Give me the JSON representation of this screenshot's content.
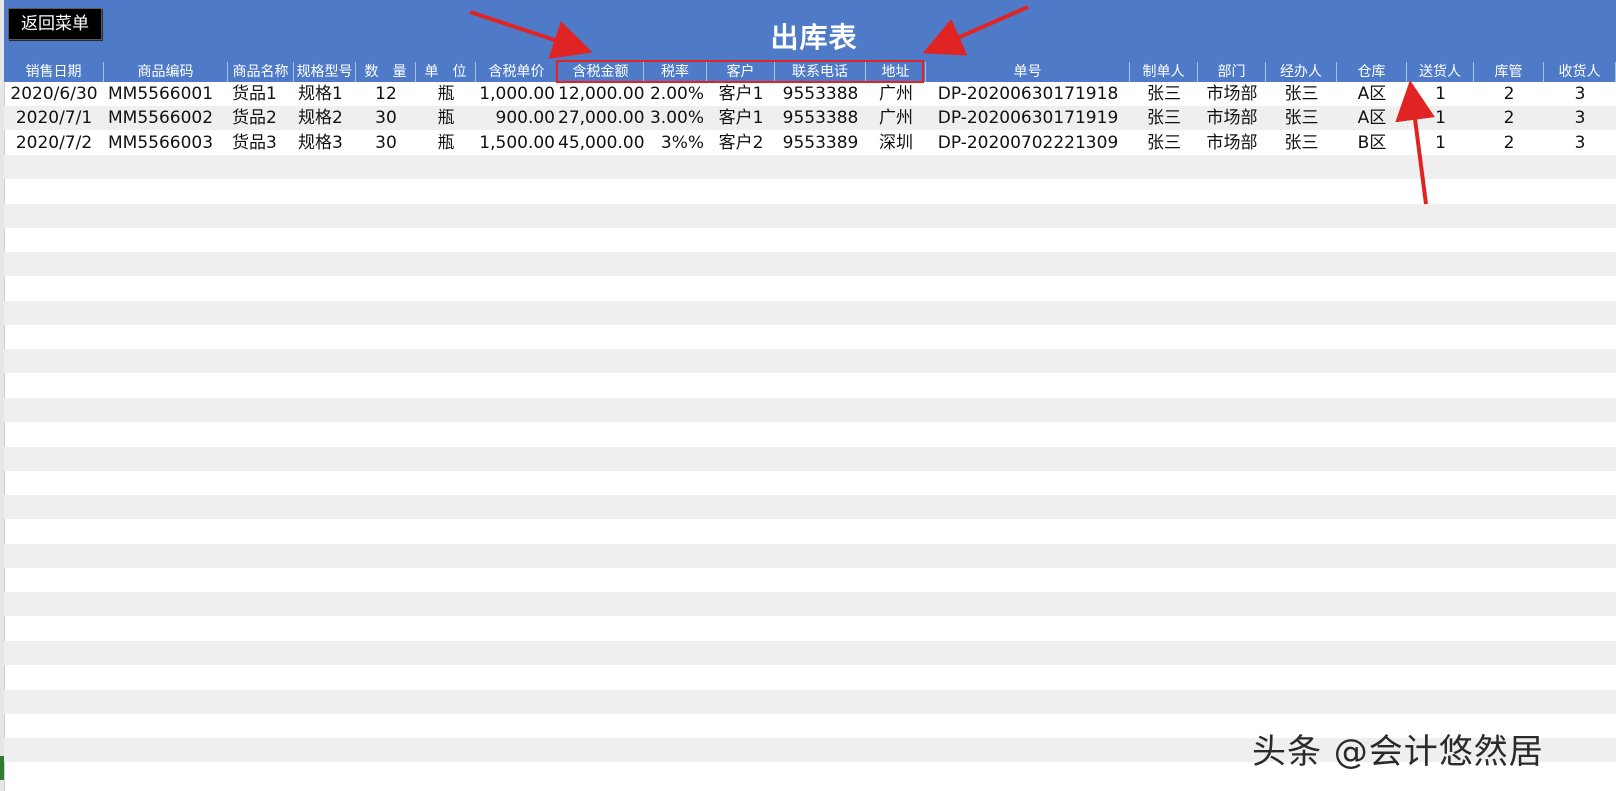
{
  "sheet": {
    "title": "出库表",
    "back_button": "返回菜单",
    "headers": [
      "销售日期",
      "商品编码",
      "商品名称",
      "规格型号",
      "数　量",
      "单　位",
      "含税单价",
      "含税金额",
      "税率",
      "客户",
      "联系电话",
      "地址",
      "单号",
      "制单人",
      "部门",
      "经办人",
      "仓库",
      "送货人",
      "库管",
      "收货人"
    ],
    "rows": [
      [
        "2020/6/30",
        "MM5566001",
        "货品1",
        "规格1",
        "12",
        "瓶",
        "1,000.00",
        "12,000.00",
        "2.00%",
        "客户1",
        "9553388",
        "广州",
        "DP-20200630171918",
        "张三",
        "市场部",
        "张三",
        "A区",
        "1",
        "2",
        "3"
      ],
      [
        "2020/7/1",
        "MM5566002",
        "货品2",
        "规格2",
        "30",
        "瓶",
        "900.00",
        "27,000.00",
        "3.00%",
        "客户1",
        "9553388",
        "广州",
        "DP-20200630171919",
        "张三",
        "市场部",
        "张三",
        "A区",
        "1",
        "2",
        "3"
      ],
      [
        "2020/7/2",
        "MM5566003",
        "货品3",
        "规格3",
        "30",
        "瓶",
        "1,500.00",
        "45,000.00",
        "3%%",
        "客户2",
        "9553389",
        "深圳",
        "DP-20200702221309",
        "张三",
        "市场部",
        "张三",
        "B区",
        "1",
        "2",
        "3"
      ]
    ]
  },
  "watermark": "头条 @会计悠然居",
  "colors": {
    "header_bg": "#4e7ac7",
    "stripe": "#efefef",
    "annotation": "#e02424"
  }
}
